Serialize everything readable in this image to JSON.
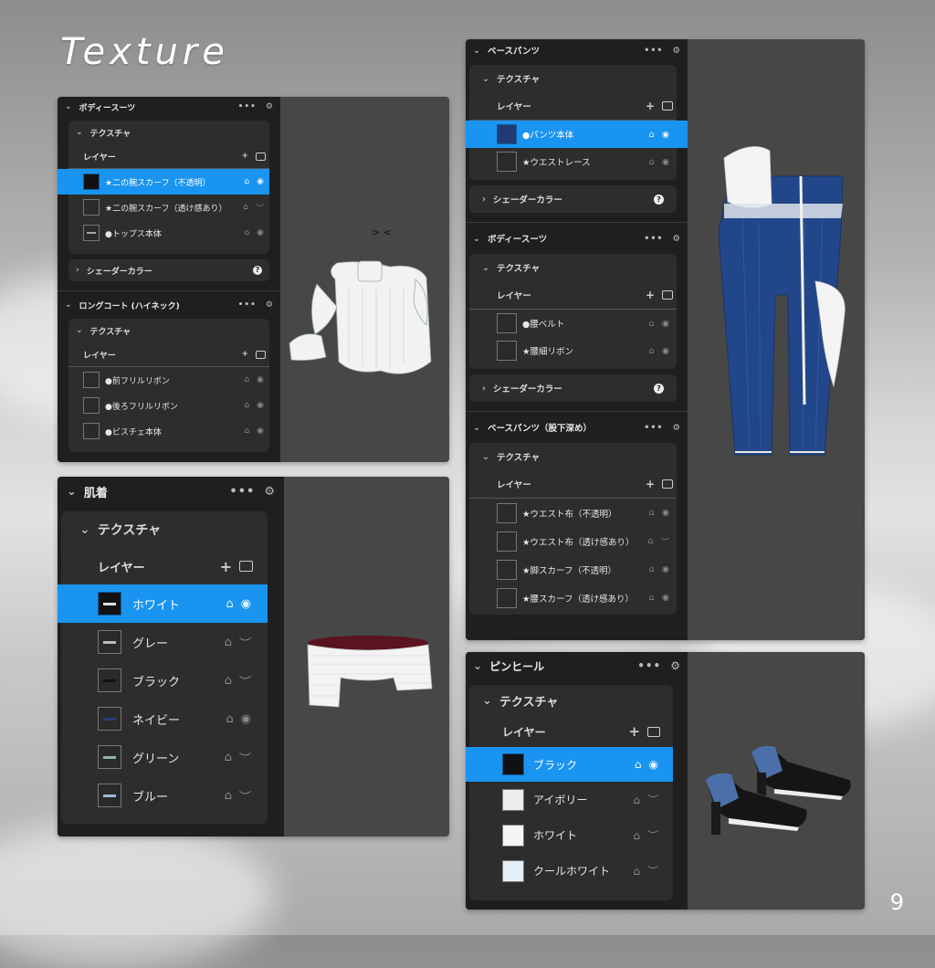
{
  "title": "Texture",
  "page_number": "9",
  "common": {
    "texture_label": "テクスチャ",
    "layer_label": "レイヤー",
    "shader_label": "シェーダーカラー",
    "plus": "+",
    "dots": "•••",
    "chev_down": "⌄",
    "chev_right": "›",
    "lock": "🔒",
    "eye": "👁",
    "help": "?"
  },
  "card1": {
    "section1": {
      "title": "ボディースーツ",
      "layers": [
        {
          "label": "★二の腕スカーフ（不透明）",
          "selected": true
        },
        {
          "label": "★二の腕スカーフ（透け感あり）"
        },
        {
          "label": "●トップス本体"
        }
      ]
    },
    "section2": {
      "title": "ロングコート (ハイネック)",
      "layers": [
        {
          "label": "●前フリルリボン"
        },
        {
          "label": "●後ろフリルリボン"
        },
        {
          "label": "●ビスチェ本体"
        }
      ]
    }
  },
  "card2": {
    "section1": {
      "title": "肌着",
      "layers": [
        {
          "label": "ホワイト",
          "selected": true
        },
        {
          "label": "グレー"
        },
        {
          "label": "ブラック"
        },
        {
          "label": "ネイビー"
        },
        {
          "label": "グリーン"
        },
        {
          "label": "ブルー"
        }
      ]
    }
  },
  "card3": {
    "section1": {
      "title": "ベースパンツ",
      "layers": [
        {
          "label": "●パンツ本体",
          "selected": true
        },
        {
          "label": "★ウエストレース"
        }
      ]
    },
    "section2": {
      "title": "ボディースーツ",
      "layers": [
        {
          "label": "●腰ベルト"
        },
        {
          "label": "★腰細リボン"
        }
      ]
    },
    "section3": {
      "title": "ベースパンツ（股下深め）",
      "layers": [
        {
          "label": "★ウエスト布（不透明）"
        },
        {
          "label": "★ウエスト布（透け感あり）"
        },
        {
          "label": "★脚スカーフ（不透明）"
        },
        {
          "label": "★腰スカーフ（透け感あり）"
        }
      ]
    }
  },
  "card4": {
    "section1": {
      "title": "ピンヒール",
      "layers": [
        {
          "label": "ブラック",
          "selected": true
        },
        {
          "label": "アイボリー"
        },
        {
          "label": "ホワイト"
        },
        {
          "label": "クールホワイト"
        }
      ]
    }
  },
  "colors": {
    "accent": "#1994f0",
    "panel": "#1f1f1f",
    "box": "#2d2d2d",
    "viewport": "#474747",
    "denim": "#22468a"
  }
}
